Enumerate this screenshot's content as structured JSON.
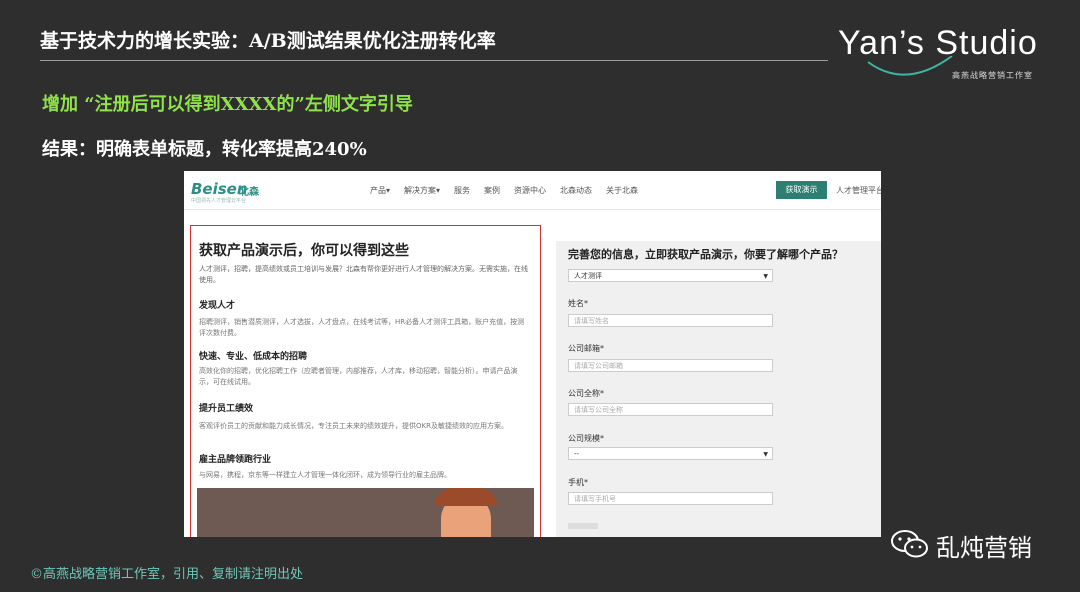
{
  "slide": {
    "title": "基于技术力的增长实验：A/B测试结果优化注册转化率",
    "line1": "增加 “注册后可以得到XXXX的”左侧文字引导",
    "line2": "结果：明确表单标题，转化率提高240%",
    "footer": "©高燕战略营销工作室，引用、复制请注明出处",
    "wechat": "乱炖营销"
  },
  "logo": {
    "text": "Yan’s Studio",
    "sub": "高燕战略营销工作室"
  },
  "screenshot": {
    "nav": {
      "brand": "Beisen",
      "brand_cn": "北森",
      "brand_sub": "中国领先人才管理云平台",
      "items": [
        "产品▾",
        "解决方案▾",
        "服务",
        "案例",
        "资源中心",
        "北森动态",
        "关于北森"
      ],
      "cta": "获取演示",
      "more": "人才管理平台"
    },
    "left": {
      "title": "获取产品演示后，你可以得到这些",
      "intro": "人才测评，招聘，提高绩效或员工培训与发展？北森有帮你更好进行人才管理的解决方案。无需实施，在线使用。",
      "sections": [
        {
          "heading": "发现人才",
          "text": "招聘测评，销售潜质测评，人才选拔，人才盘点，在线考试等，HR必备人才测评工具箱，账户充值，按测评次数付费。"
        },
        {
          "heading": "快速、专业、低成本的招聘",
          "text": "高效化你的招聘，优化招聘工作（应聘者管理，内部推荐，人才库，移动招聘，智能分析）。申请产品演示，可在线试用。"
        },
        {
          "heading": "提升员工绩效",
          "text": "客观评价员工的贡献和能力成长情况，专注员工未来的绩效提升，提供OKR及敏捷绩效的应用方案。"
        },
        {
          "heading": "雇主品牌领跑行业",
          "text": "与网易，携程，京东等一样建立人才管理一体化闭环，成为领导行业的雇主品牌。"
        }
      ]
    },
    "right": {
      "title": "完善您的信息，立即获取产品演示，你要了解哪个产品？",
      "product_select": "人才测评",
      "fields": [
        {
          "label": "姓名*",
          "placeholder": "请填写姓名"
        },
        {
          "label": "公司邮箱*",
          "placeholder": "请填写公司邮箱"
        },
        {
          "label": "公司全称*",
          "placeholder": "请填写公司全称"
        }
      ],
      "scale_label": "公司规模*",
      "scale_select": "--",
      "phone_label": "手机*",
      "phone_placeholder": "请填写手机号"
    }
  }
}
